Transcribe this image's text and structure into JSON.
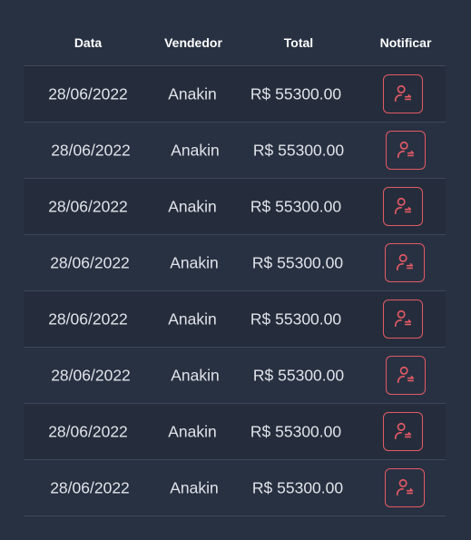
{
  "table": {
    "headers": {
      "date": "Data",
      "seller": "Vendedor",
      "total": "Total",
      "notify": "Notificar"
    },
    "rows": [
      {
        "date": "28/06/2022",
        "seller": "Anakin",
        "total": "R$ 55300.00"
      },
      {
        "date": "28/06/2022",
        "seller": "Anakin",
        "total": "R$ 55300.00"
      },
      {
        "date": "28/06/2022",
        "seller": "Anakin",
        "total": "R$ 55300.00"
      },
      {
        "date": "28/06/2022",
        "seller": "Anakin",
        "total": "R$ 55300.00"
      },
      {
        "date": "28/06/2022",
        "seller": "Anakin",
        "total": "R$ 55300.00"
      },
      {
        "date": "28/06/2022",
        "seller": "Anakin",
        "total": "R$ 55300.00"
      },
      {
        "date": "28/06/2022",
        "seller": "Anakin",
        "total": "R$ 55300.00"
      },
      {
        "date": "28/06/2022",
        "seller": "Anakin",
        "total": "R$ 55300.00"
      }
    ],
    "notify_icon": "user-notify-icon"
  },
  "colors": {
    "background": "#283142",
    "row_alt": "#252d3c",
    "accent": "#e35a64",
    "text": "#e0e3e9"
  }
}
